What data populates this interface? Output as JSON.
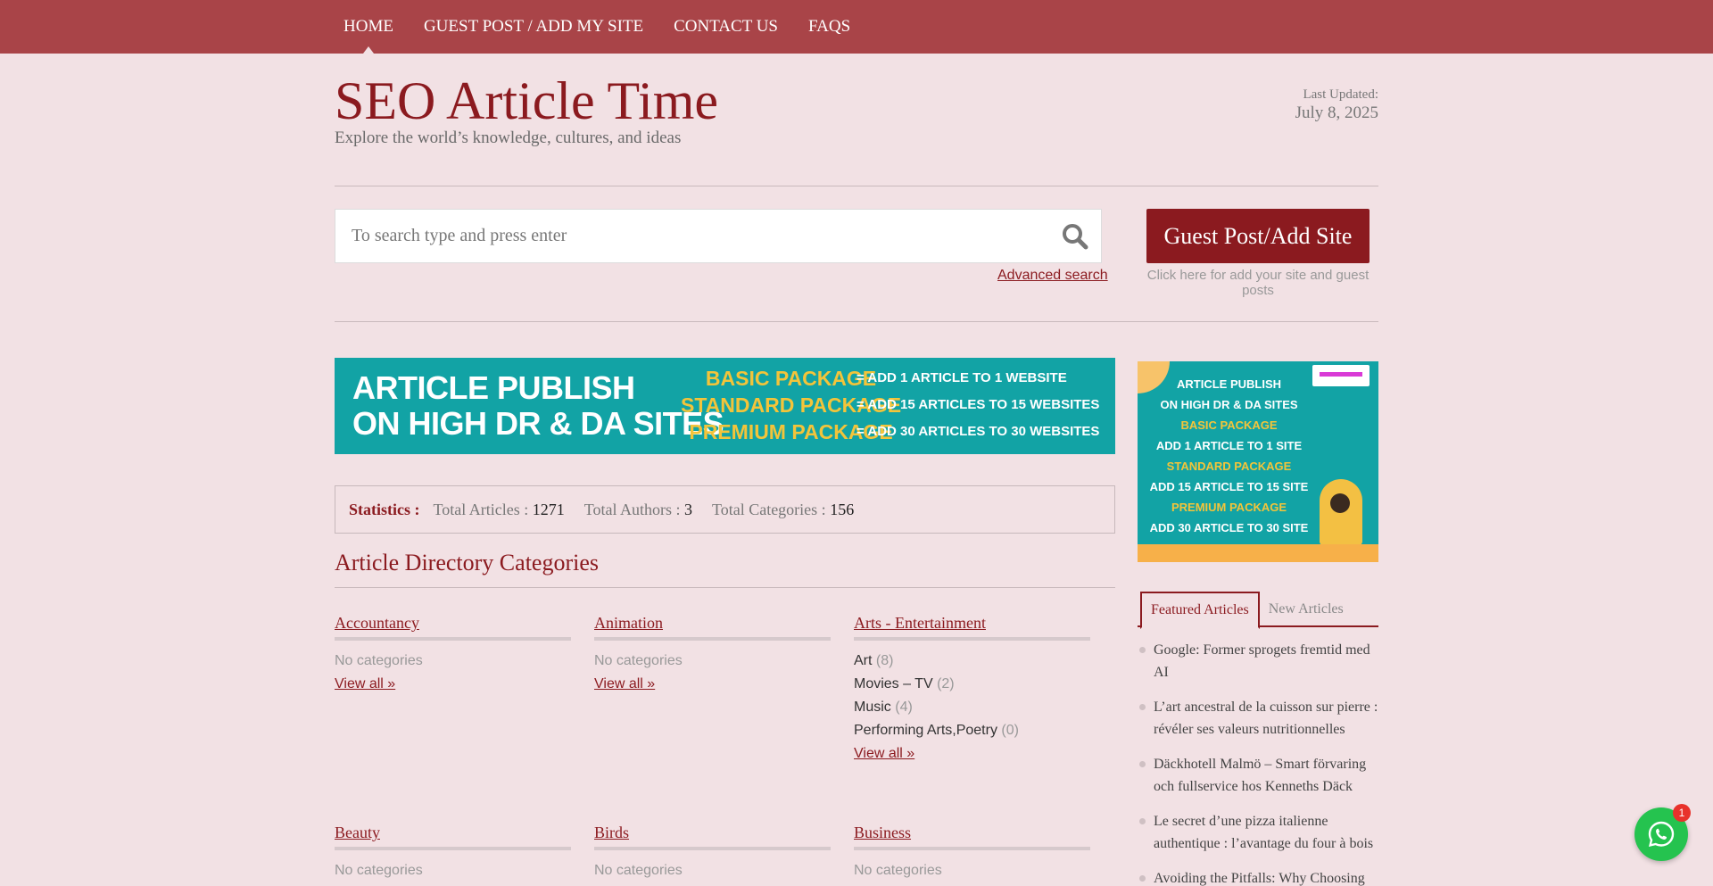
{
  "nav": {
    "items": [
      {
        "label": "HOME",
        "active": true
      },
      {
        "label": "GUEST POST / ADD MY SITE"
      },
      {
        "label": "CONTACT US"
      },
      {
        "label": "FAQS"
      }
    ]
  },
  "header": {
    "title": "SEO Article Time",
    "tagline": "Explore the world’s knowledge, cultures, and ideas",
    "updated_label": "Last Updated:",
    "updated_date": "July 8, 2025"
  },
  "search": {
    "placeholder": "To search type and press enter",
    "advanced_label": "Advanced search"
  },
  "guest": {
    "button_label": "Guest Post/Add Site",
    "note": "Click here for add your site and guest posts"
  },
  "banner_wide": {
    "line1": "ARTICLE PUBLISH",
    "line2": "ON HIGH DR & DA SITES",
    "packages": [
      "BASIC PACKAGE",
      "STANDARD PACKAGE",
      "PREMIUM PACKAGE"
    ],
    "values": [
      "= ADD 1 ARTICLE TO 1 WEBSITE",
      "= ADD 15 ARTICLES TO 15 WEBSITES",
      "= ADD 30 ARTICLES TO 30 WEBSITES"
    ]
  },
  "banner_side": {
    "line1": "ARTICLE PUBLISH",
    "line2": "ON HIGH DR & DA SITES",
    "p1": "BASIC PACKAGE",
    "v1": "ADD 1 ARTICLE TO 1 SITE",
    "p2": "STANDARD PACKAGE",
    "v2": "ADD 15 ARTICLE TO 15 SITE",
    "p3": "PREMIUM PACKAGE",
    "v3": "ADD 30 ARTICLE TO 30 SITE"
  },
  "stats": {
    "label": "Statistics :",
    "articles_label": "Total Articles :",
    "articles": "1271",
    "authors_label": "Total Authors :",
    "authors": "3",
    "categories_label": "Total Categories :",
    "categories": "156"
  },
  "section_title": "Article Directory Categories",
  "categories": [
    {
      "title": "Accountancy",
      "none": "No categories",
      "view_all": "View all »"
    },
    {
      "title": "Animation",
      "none": "No categories",
      "view_all": "View all »"
    },
    {
      "title": "Arts - Entertainment",
      "items": [
        {
          "name": "Art",
          "count": "(8)"
        },
        {
          "name": "Movies – TV",
          "count": "(2)"
        },
        {
          "name": "Music",
          "count": "(4)"
        },
        {
          "name": "Performing Arts,Poetry",
          "count": "(0)"
        }
      ],
      "view_all": "View all »"
    },
    {
      "title": "Beauty",
      "none": "No categories"
    },
    {
      "title": "Birds",
      "none": "No categories"
    },
    {
      "title": "Business",
      "none": "No categories"
    }
  ],
  "tabs": {
    "featured": "Featured Articles",
    "new": "New Articles"
  },
  "articles": [
    "Google: Former sprogets fremtid med AI",
    "L’art ancestral de la cuisson sur pierre : révéler ses valeurs nutritionnelles",
    "Däckhotell Malmö – Smart förvaring och fullservice hos Kenneths Däck",
    "Le secret d’une pizza italienne authentique : l’avantage du four à bois",
    "Avoiding the Pitfalls: Why Choosing"
  ],
  "whatsapp": {
    "badge": "1"
  },
  "colors": {
    "accent": "#8b1a1f",
    "nav_bg": "#a94448",
    "page_bg": "#f2e1e4",
    "banner": "#12a3a5",
    "banner_yellow": "#f3c43a"
  }
}
